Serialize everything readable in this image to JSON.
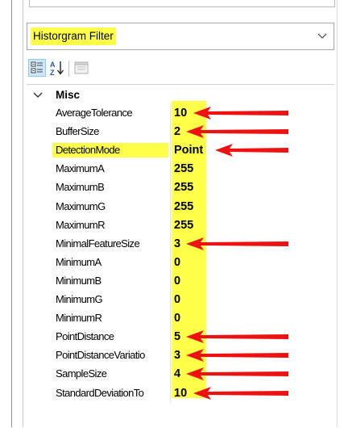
{
  "combo": {
    "selected": "Historgram Filter"
  },
  "toolbar": {
    "buttons": [
      {
        "name": "categorized-view",
        "icon": "categorized-icon",
        "active": true
      },
      {
        "name": "alphabetical-view",
        "icon": "sort-az-icon",
        "active": false
      },
      {
        "name": "property-pages",
        "icon": "property-pages-icon",
        "active": false
      }
    ]
  },
  "category": {
    "label": "Misc",
    "expanded": true
  },
  "properties": [
    {
      "name": "AverageTolerance",
      "value": "10",
      "arrow": true
    },
    {
      "name": "BufferSize",
      "value": "2",
      "arrow": true
    },
    {
      "name": "DetectionMode",
      "value": "Point",
      "arrow": true,
      "highlight": true
    },
    {
      "name": "MaximumA",
      "value": "255"
    },
    {
      "name": "MaximumB",
      "value": "255"
    },
    {
      "name": "MaximumG",
      "value": "255"
    },
    {
      "name": "MaximumR",
      "value": "255"
    },
    {
      "name": "MinimalFeatureSize",
      "value": "3",
      "arrow": true
    },
    {
      "name": "MinimumA",
      "value": "0"
    },
    {
      "name": "MinimumB",
      "value": "0"
    },
    {
      "name": "MinimumG",
      "value": "0"
    },
    {
      "name": "MinimumR",
      "value": "0"
    },
    {
      "name": "PointDistance",
      "value": "5",
      "arrow": true
    },
    {
      "name": "PointDistanceVariatio",
      "value": "3",
      "arrow": true
    },
    {
      "name": "SampleSize",
      "value": "4",
      "arrow": true
    },
    {
      "name": "StandardDeviationTo",
      "value": "10",
      "arrow": true
    }
  ],
  "colors": {
    "highlight": "#ffff4a",
    "arrow": "#ee1111"
  }
}
